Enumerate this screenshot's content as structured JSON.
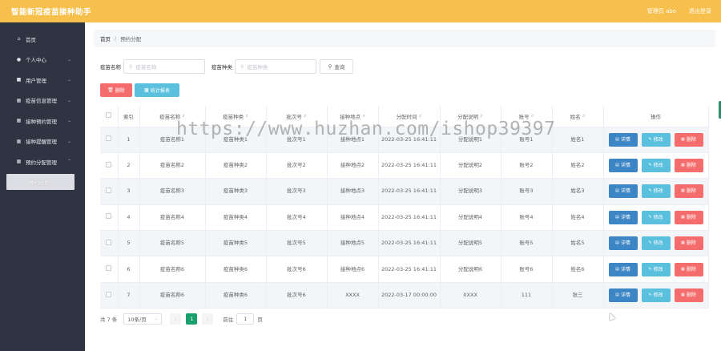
{
  "app": {
    "title": "智能新冠疫苗接种助手"
  },
  "top": {
    "user": "管理员 abo",
    "logout": "退出登录"
  },
  "sidebar": {
    "items": [
      {
        "label": "首页",
        "icon": "home-icon"
      },
      {
        "label": "个人中心",
        "icon": "user-icon"
      },
      {
        "label": "用户管理",
        "icon": "users-icon"
      },
      {
        "label": "疫苗信息管理",
        "icon": "grid-icon"
      },
      {
        "label": "接种预约管理",
        "icon": "grid-icon"
      },
      {
        "label": "接种提醒管理",
        "icon": "grid-icon"
      },
      {
        "label": "预约分配管理",
        "icon": "grid-icon"
      }
    ],
    "sub_active": "预约分配"
  },
  "breadcrumb": {
    "home": "首页",
    "sep": "/",
    "current": "预约分配"
  },
  "search": {
    "name_label": "疫苗名称",
    "name_placeholder": "疫苗名称",
    "type_label": "疫苗种类",
    "type_placeholder": "疫苗种类",
    "query_button": "查询"
  },
  "actions": {
    "delete": "删除",
    "stats": "统计报表"
  },
  "table": {
    "headers": [
      "索引",
      "疫苗名称",
      "疫苗种类",
      "批次号",
      "接种地点",
      "分配时间",
      "分配说明",
      "账号",
      "姓名",
      "操作"
    ],
    "rows": [
      [
        "1",
        "疫苗名称1",
        "疫苗种类1",
        "批次号1",
        "接种地点1",
        "2022-03-25 16:41:11",
        "分配说明1",
        "账号1",
        "姓名1"
      ],
      [
        "2",
        "疫苗名称2",
        "疫苗种类2",
        "批次号2",
        "接种地点2",
        "2022-03-25 16:41:11",
        "分配说明2",
        "账号2",
        "姓名2"
      ],
      [
        "3",
        "疫苗名称3",
        "疫苗种类3",
        "批次号3",
        "接种地点3",
        "2022-03-25 16:41:11",
        "分配说明3",
        "账号3",
        "姓名3"
      ],
      [
        "4",
        "疫苗名称4",
        "疫苗种类4",
        "批次号4",
        "接种地点4",
        "2022-03-25 16:41:11",
        "分配说明4",
        "账号4",
        "姓名4"
      ],
      [
        "5",
        "疫苗名称5",
        "疫苗种类5",
        "批次号5",
        "接种地点5",
        "2022-03-25 16:41:11",
        "分配说明5",
        "账号5",
        "姓名5"
      ],
      [
        "6",
        "疫苗名称6",
        "疫苗种类6",
        "批次号6",
        "接种地点6",
        "2022-03-25 16:41:11",
        "分配说明6",
        "账号6",
        "姓名6"
      ],
      [
        "7",
        "疫苗名称6",
        "疫苗种类6",
        "批次号6",
        "XXXX",
        "2022-03-17 00:00:00",
        "XXXX",
        "111",
        "张三"
      ]
    ],
    "row_ops": {
      "detail": "详情",
      "edit": "修改",
      "delete": "删除"
    }
  },
  "pagination": {
    "total": "共 7 条",
    "page_size": "10条/页",
    "current_page": "1",
    "goto_prefix": "前往",
    "goto_value": "1",
    "goto_suffix": "页"
  },
  "watermark": "https://www.huzhan.com/ishop39397",
  "colors": {
    "topbar": "#f7c04d",
    "sidebar": "#2f3443",
    "danger": "#f56c6c",
    "info": "#5bc0de",
    "primary": "#3d86c6",
    "page_active": "#19a06e"
  }
}
